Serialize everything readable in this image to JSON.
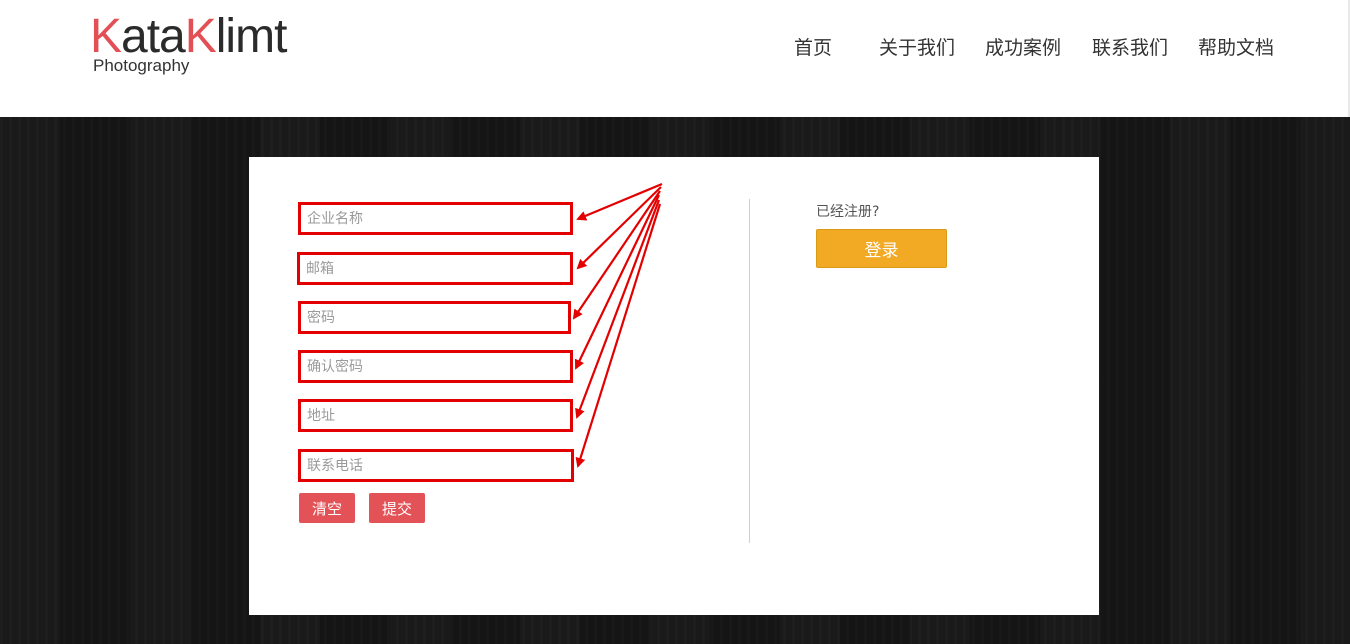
{
  "header": {
    "logo": {
      "part1": "K",
      "part2": "ata",
      "part3": "K",
      "part4": "limt",
      "subtitle": "Photography"
    },
    "nav": [
      {
        "label": "首页"
      },
      {
        "label": "关于我们"
      },
      {
        "label": "成功案例"
      },
      {
        "label": "联系我们"
      },
      {
        "label": "帮助文档"
      }
    ]
  },
  "form": {
    "fields": [
      {
        "placeholder": "企业名称",
        "value": ""
      },
      {
        "placeholder": "邮箱",
        "value": ""
      },
      {
        "placeholder": "密码",
        "value": ""
      },
      {
        "placeholder": "确认密码",
        "value": ""
      },
      {
        "placeholder": "地址",
        "value": ""
      },
      {
        "placeholder": "联系电话",
        "value": ""
      }
    ],
    "clear_label": "清空",
    "submit_label": "提交"
  },
  "login": {
    "prompt": "已经注册?",
    "button_label": "登录"
  },
  "colors": {
    "brand_red": "#e25055",
    "annotation_red": "#e30000",
    "login_orange": "#f2aa25",
    "background_dark": "#161616"
  }
}
